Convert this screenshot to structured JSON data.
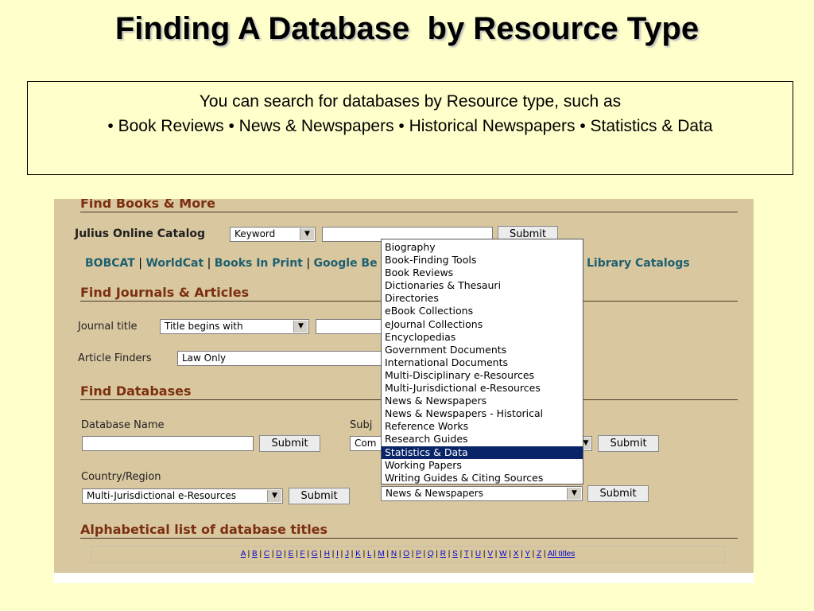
{
  "slide": {
    "title": "Finding A Database  by Resource Type",
    "info_line1": "You can search for databases by Resource type, such as",
    "info_line2": "• Book Reviews • News & Newspapers • Historical Newspapers • Statistics & Data"
  },
  "books": {
    "heading": "Find Books & More",
    "catalog_label": "Julius Online Catalog",
    "catalog_select": "Keyword",
    "submit": "Submit",
    "links": [
      "BOBCAT",
      "WorldCat",
      "Books In Print",
      "Google Be"
    ],
    "library_catalogs": "Library Catalogs"
  },
  "journals": {
    "heading": "Find Journals & Articles",
    "journal_label": "Journal title",
    "journal_select": "Title begins with",
    "finders_label": "Article Finders",
    "finders_select": "Law Only"
  },
  "databases": {
    "heading": "Find Databases",
    "name_label": "Database Name",
    "subject_label": "Subj",
    "subject_select": "Com",
    "submit": "Submit",
    "country_label": "Country/Region",
    "country_select": "Multi-Jurisdictional e-Resources",
    "resource_select": "News & Newspapers"
  },
  "dropdown": {
    "options": [
      "Biography",
      "Book-Finding Tools",
      "Book Reviews",
      "Dictionaries & Thesauri",
      "Directories",
      "eBook Collections",
      "eJournal Collections",
      "Encyclopedias",
      "Government Documents",
      "International Documents",
      "Multi-Disciplinary e-Resources",
      "Multi-Jurisdictional e-Resources",
      "News & Newspapers",
      "News & Newspapers - Historical",
      "Reference Works",
      "Research Guides",
      "Statistics & Data",
      "Working Papers",
      "Writing Guides & Citing Sources"
    ],
    "selected": "Statistics & Data"
  },
  "alphabetical": {
    "heading": "Alphabetical list of database titles",
    "letters": [
      "A",
      "B",
      "C",
      "D",
      "E",
      "F",
      "G",
      "H",
      "I",
      "J",
      "K",
      "L",
      "M",
      "N",
      "O",
      "P",
      "Q",
      "R",
      "S",
      "T",
      "U",
      "V",
      "W",
      "X",
      "Y",
      "Z"
    ],
    "all_titles": "All titles"
  },
  "colors": {
    "background": "#ffffcc",
    "panel": "#d9c7a0",
    "heading": "#7b2f10",
    "link": "#1d5f6e",
    "selected_option": "#0a246a"
  }
}
